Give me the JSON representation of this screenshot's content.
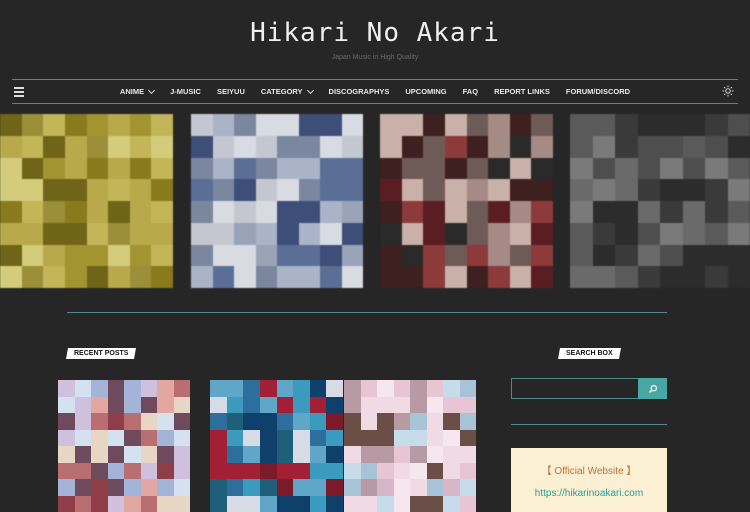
{
  "site": {
    "title": "Hikari No Akari",
    "tagline": "Japan Music in High Quality"
  },
  "nav": {
    "menu_icon": "hamburger-icon",
    "theme_icon": "sun-icon",
    "items": [
      {
        "label": "ANIME",
        "dropdown": true
      },
      {
        "label": "J-MUSIC",
        "dropdown": false
      },
      {
        "label": "SEIYUU",
        "dropdown": false
      },
      {
        "label": "CATEGORY",
        "dropdown": true
      },
      {
        "label": "DISCOGRAPHYS",
        "dropdown": false
      },
      {
        "label": "UPCOMING",
        "dropdown": false
      },
      {
        "label": "FAQ",
        "dropdown": false
      },
      {
        "label": "REPORT LINKS",
        "dropdown": false
      },
      {
        "label": "FORUM/DISCORD",
        "dropdown": false
      }
    ]
  },
  "sections": {
    "recent_posts": "RECENT POSTS",
    "search_box": "SEARCH BOX"
  },
  "search": {
    "placeholder": "",
    "button_icon": "search-icon"
  },
  "widget": {
    "official_label": "【 Official Website 】",
    "url": "https://hikarinoakari.com"
  },
  "colors": {
    "background": "#262626",
    "accent": "#4d8d86",
    "search_button": "#49a7a3",
    "widget_bg": "#fbf0d3",
    "official_text": "#c0703a",
    "url_text": "#2a9d95"
  }
}
